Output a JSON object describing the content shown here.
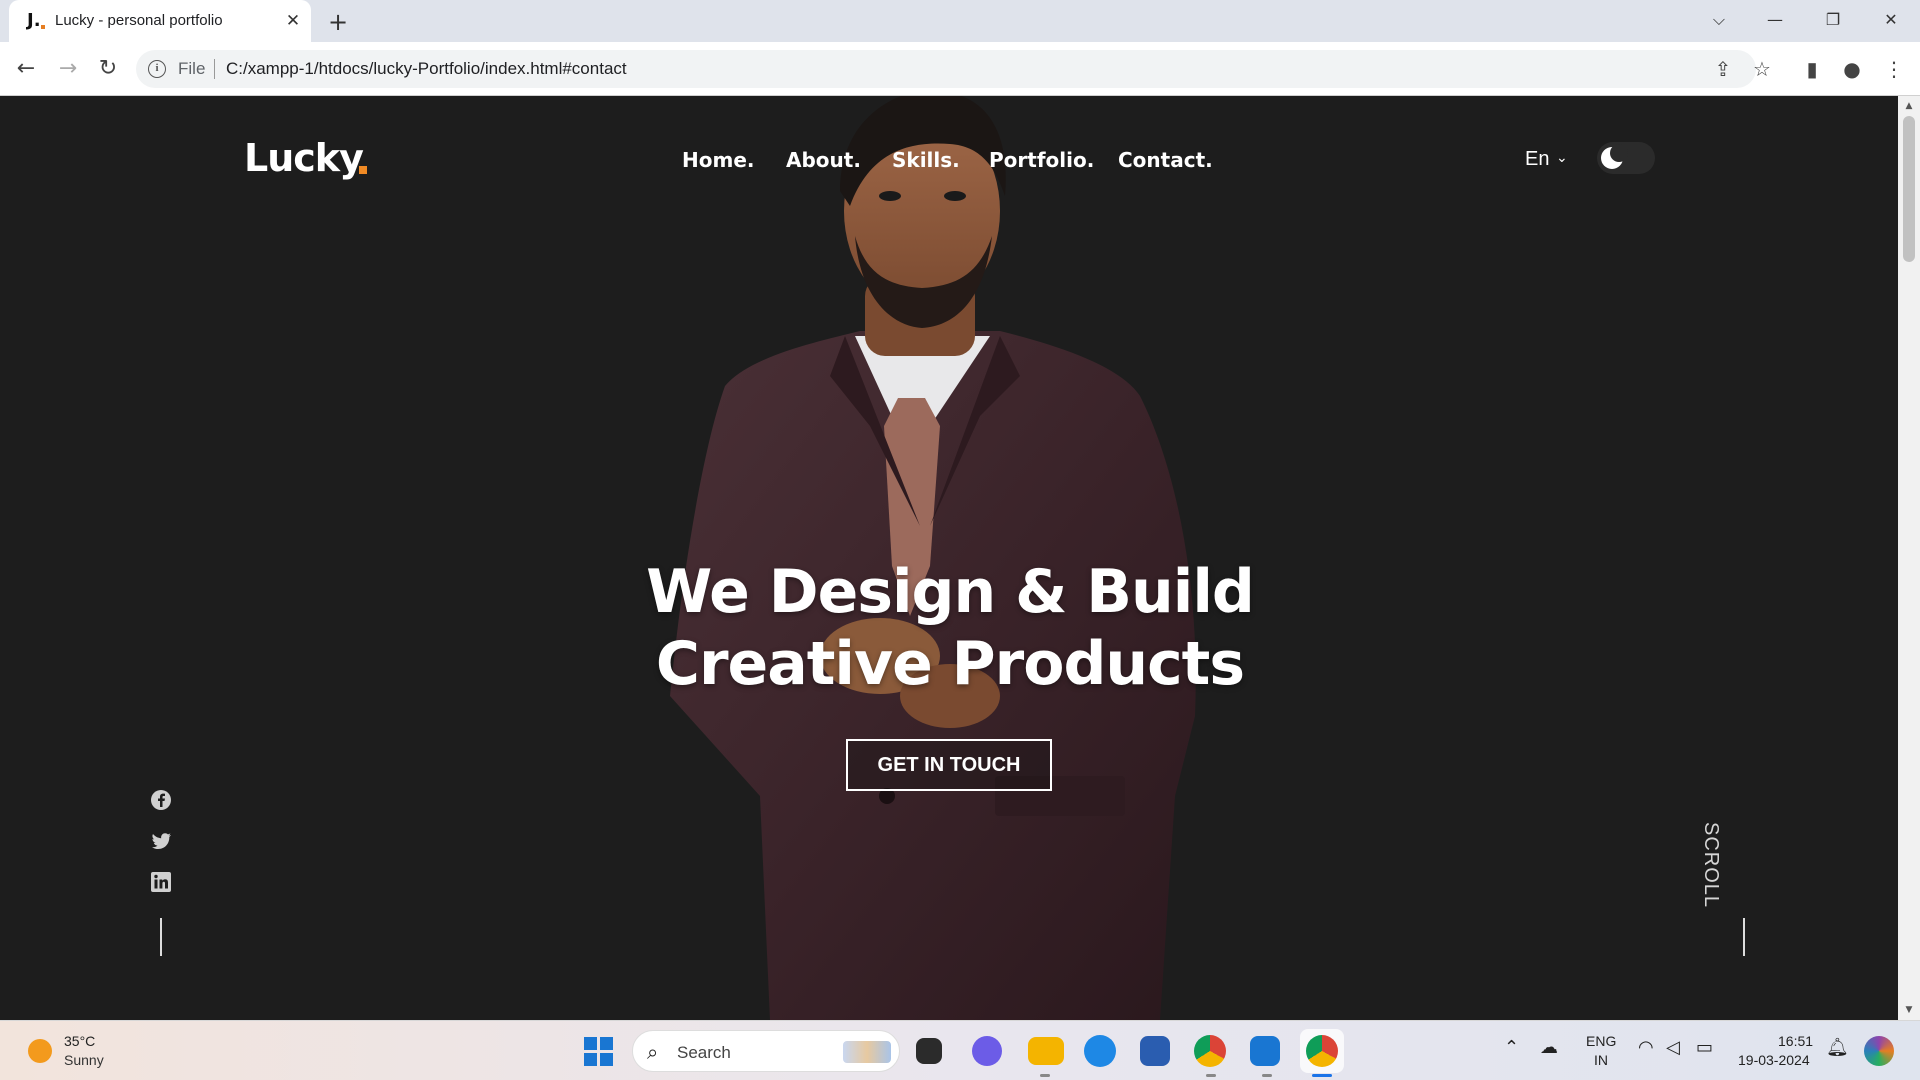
{
  "browser": {
    "tab_title": "Lucky - personal portfolio",
    "tab_favicon": "J.",
    "address_prefix": "File",
    "url": "C:/xampp-1/htdocs/lucky-Portfolio/index.html#contact"
  },
  "site": {
    "logo": "Lucky",
    "accent_color": "#f08a24",
    "nav": [
      "Home.",
      "About.",
      "Skills.",
      "Portfolio.",
      "Contact."
    ],
    "language": "En",
    "hero_line1": "We Design & Build",
    "hero_line2": "Creative Products",
    "cta": "GET IN TOUCH",
    "scroll_label": "SCROLL",
    "social_icons": [
      "facebook-icon",
      "twitter-icon",
      "linkedin-icon"
    ]
  },
  "taskbar": {
    "temperature": "35°C",
    "weather": "Sunny",
    "search_label": "Search",
    "lang_top": "ENG",
    "lang_bottom": "IN",
    "time": "16:51",
    "date": "19-03-2024"
  }
}
